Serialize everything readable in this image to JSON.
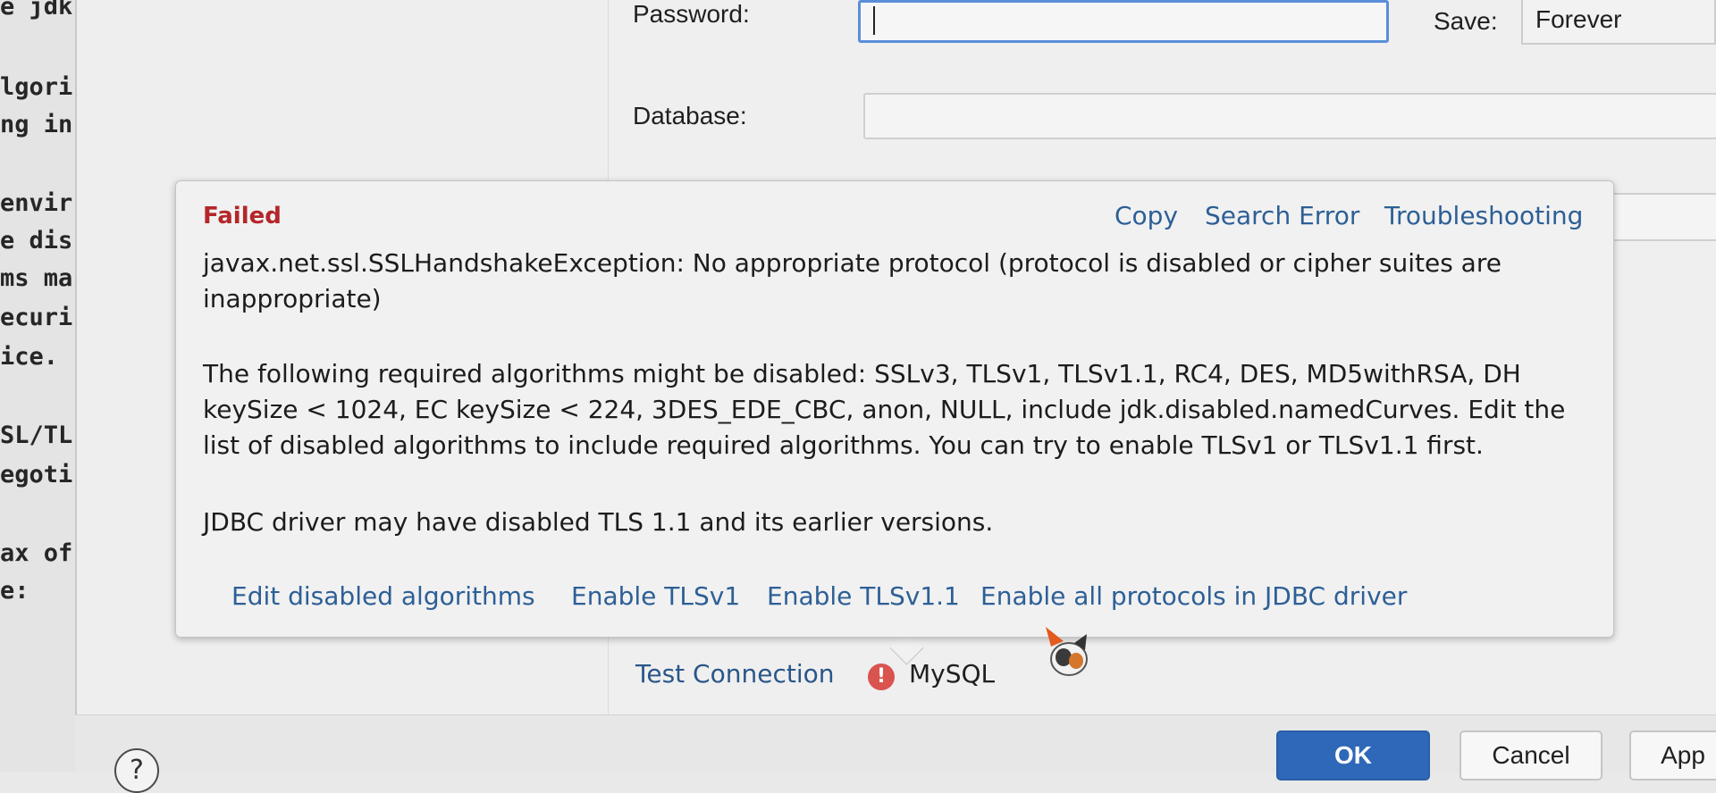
{
  "code_lines": [
    "e jdk",
    "lgori",
    "ng in",
    "envir",
    "e dis",
    "ms ma",
    "ecuri",
    "ice.",
    "SL/TL",
    "egoti",
    "ax of",
    "e:"
  ],
  "form": {
    "password_label": "Password:",
    "password_value": "",
    "save_label": "Save:",
    "save_value": "Forever",
    "database_label": "Database:",
    "database_value": ""
  },
  "popup": {
    "status": "Failed",
    "links": [
      "Copy",
      "Search Error",
      "Troubleshooting"
    ],
    "exception": "javax.net.ssl.SSLHandshakeException: No appropriate protocol (protocol is disabled or cipher suites are inappropriate)",
    "algorithms_note": "The following required algorithms might be disabled: SSLv3, TLSv1, TLSv1.1, RC4, DES, MD5withRSA, DH keySize < 1024, EC keySize < 224, 3DES_EDE_CBC, anon, NULL, include jdk.disabled.namedCurves. Edit the list of disabled algorithms to include required algorithms. You can try to enable TLSv1 or TLSv1.1 first.",
    "driver_note": "JDBC driver may have disabled TLS 1.1 and its earlier versions.",
    "actions": [
      "Edit disabled algorithms",
      "Enable TLSv1",
      "Enable TLSv1.1",
      "Enable all protocols in JDBC driver"
    ]
  },
  "status_row": {
    "test_connection": "Test Connection",
    "error_icon": "!",
    "driver": "MySQL"
  },
  "buttons": {
    "help": "?",
    "ok": "OK",
    "cancel": "Cancel",
    "apply": "App"
  },
  "colors": {
    "failed": "#b4262a",
    "link": "#2d5f96",
    "ok_button": "#2f68b8",
    "error_icon": "#d9534f"
  }
}
